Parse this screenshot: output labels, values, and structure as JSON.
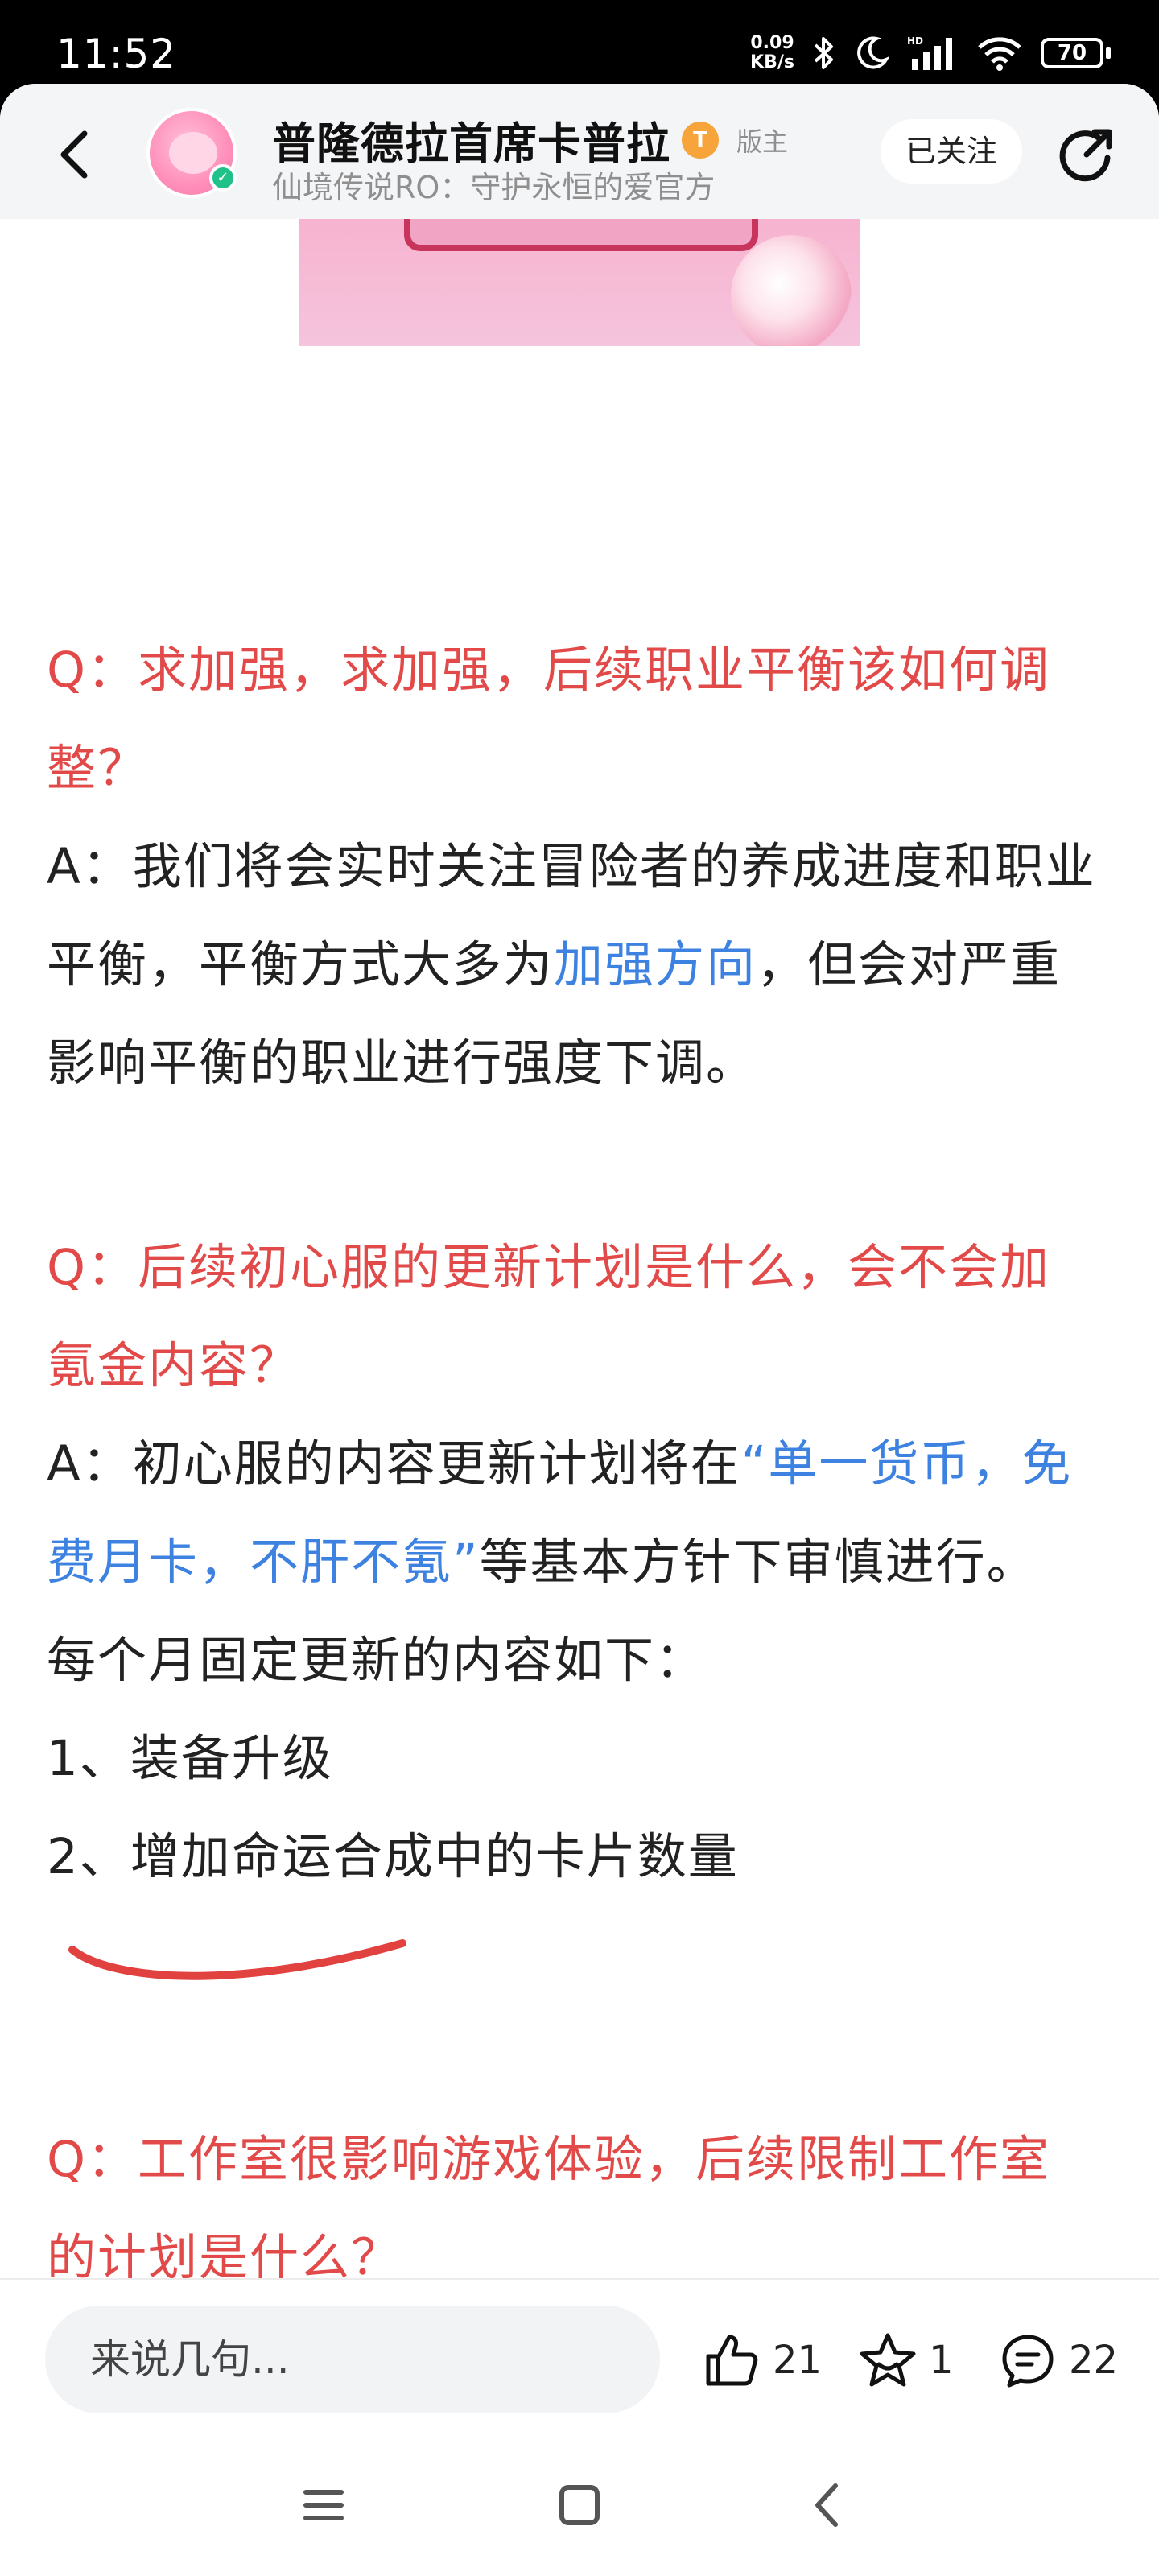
{
  "status_bar": {
    "time": "11:52",
    "net_speed_value": "0.09",
    "net_speed_unit": "KB/s",
    "battery": "70"
  },
  "header": {
    "forum_title": "普隆德拉首席卡普拉",
    "level_badge": "T",
    "role_tag": "版主",
    "subtitle": "仙境传说RO：守护永恒的爱官方",
    "follow_label": "已关注"
  },
  "post": {
    "q1_lines": [
      "Q：求加强，求加强，后续职业平衡该如何调",
      "整？"
    ],
    "a1_line1": "A：我们将会实时关注冒险者的养成进度和职业",
    "a1_line2_prefix": "平衡，平衡方式大多为",
    "a1_line2_highlight": "加强方向",
    "a1_line2_suffix": "，但会对严重",
    "a1_line3": "影响平衡的职业进行强度下调。",
    "q2_lines": [
      "Q：后续初心服的更新计划是什么，会不会加",
      "氪金内容？"
    ],
    "a2_line1_prefix": "A：初心服的内容更新计划将在",
    "a2_line1_highlight": "“单一货币，免",
    "a2_line2_highlight": "费月卡，不肝不氪”",
    "a2_line2_suffix": "等基本方针下审慎进行。",
    "a2_line3": "每个月固定更新的内容如下：",
    "a2_item1": "1、装备升级",
    "a2_item2": "2、增加命运合成中的卡片数量",
    "q3_lines": [
      "Q：工作室很影响游戏体验，后续限制工作室",
      "的计划是什么？"
    ]
  },
  "comment_bar": {
    "placeholder": "来说几句...",
    "like_count": "21",
    "favorite_count": "1",
    "comment_count": "22"
  },
  "colors": {
    "question_red": "#e24a4a",
    "highlight_blue": "#3d82e0",
    "annotation_red": "#e2423f"
  }
}
